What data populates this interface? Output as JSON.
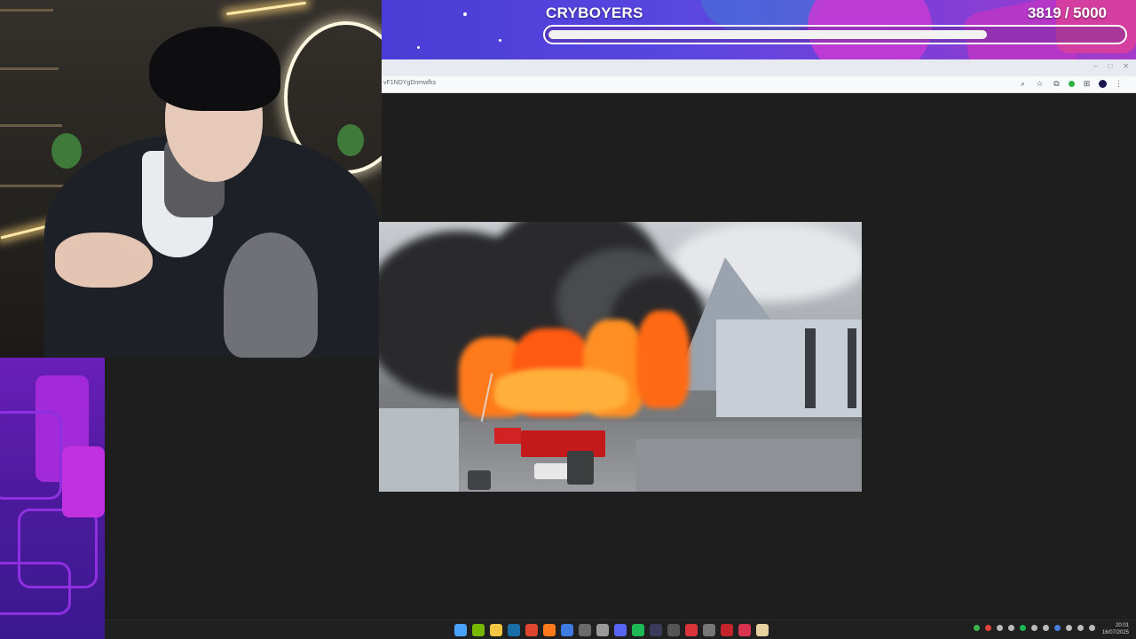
{
  "goal": {
    "title": "CRYBOYERS",
    "current": "3819",
    "target": "/ 5000",
    "progress_fraction": 0.764,
    "colors": {
      "start": "#4a3cd6",
      "end": "#a53ac9"
    }
  },
  "browser": {
    "url_fragment": "vF1NDYgDnmwfks",
    "toolbar_icons": [
      "zoom-icon",
      "star-icon",
      "extensions-icon",
      "profile-avatar"
    ]
  },
  "video": {
    "description_icon": "video-player"
  },
  "taskbar": {
    "apps": [
      {
        "name": "start-icon",
        "color": "#4aa3ff"
      },
      {
        "name": "nvidia-icon",
        "color": "#76b900"
      },
      {
        "name": "explorer-icon",
        "color": "#f4c542"
      },
      {
        "name": "steam-icon",
        "color": "#1b6fa8"
      },
      {
        "name": "chrome-icon",
        "color": "#e0452f"
      },
      {
        "name": "firefox-icon",
        "color": "#ff7a1a"
      },
      {
        "name": "app-blue-icon",
        "color": "#3d7be0"
      },
      {
        "name": "app-generic-icon",
        "color": "#6a6a6a"
      },
      {
        "name": "settings-icon",
        "color": "#9a9a9a"
      },
      {
        "name": "discord-icon",
        "color": "#5865f2"
      },
      {
        "name": "spotify-icon",
        "color": "#1db954"
      },
      {
        "name": "app-dark-icon",
        "color": "#3a3a5a"
      },
      {
        "name": "app-stream-icon",
        "color": "#555"
      },
      {
        "name": "app-red-icon",
        "color": "#d8343a"
      },
      {
        "name": "app-gray-icon",
        "color": "#777"
      },
      {
        "name": "app-red2-icon",
        "color": "#c3252b"
      },
      {
        "name": "app-t-icon",
        "color": "#d8334f"
      },
      {
        "name": "app-brush-icon",
        "color": "#e8d3a0"
      }
    ],
    "clock_time": "20:01",
    "clock_date": "16/07/2025"
  }
}
